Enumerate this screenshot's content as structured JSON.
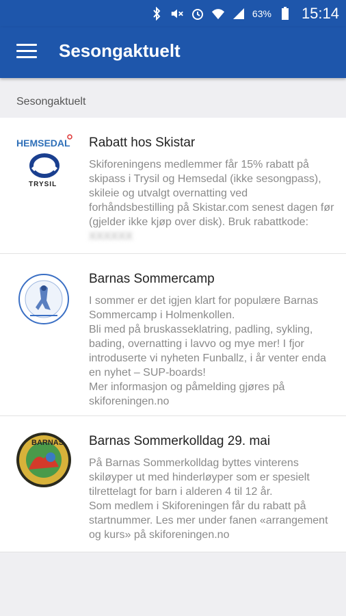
{
  "status_bar": {
    "battery_pct": "63%",
    "time": "15:14",
    "icons": [
      "bluetooth-icon",
      "mute-icon",
      "alarm-icon",
      "wifi-icon",
      "signal-icon",
      "battery-icon"
    ]
  },
  "app_bar": {
    "title": "Sesongaktuelt"
  },
  "section": {
    "header": "Sesongaktuelt"
  },
  "items": [
    {
      "title": "Rabatt hos Skistar",
      "body": "Skiforeningens medlemmer får 15% rabatt på skipass i Trysil og Hemsedal (ikke sesongpass), skileie og utvalgt overnatting ved forhåndsbestilling på Skistar.com senest dagen før (gjelder ikke kjøp over disk). Bruk rabattkode:",
      "redacted_code": "XXXXXX",
      "logo_text_top": "HEMSEDAL",
      "logo_text_bottom": "TRYSIL"
    },
    {
      "title": "Barnas Sommercamp",
      "body": "I sommer er det igjen klart for populære Barnas Sommercamp i Holmenkollen.\nBli med på bruskasseklatring, padling, sykling, bading, overnatting i lavvo og mye mer! I fjor introduserte vi nyheten Funballz, i år venter enda en nyhet – SUP-boards!\nMer informasjon og påmelding gjøres på skiforeningen.no"
    },
    {
      "title": "Barnas Sommerkolldag 29. mai",
      "body": "På Barnas Sommerkolldag byttes vinterens skiløyper ut med hinderløyper som er spesielt tilrettelagt for barn i alderen 4 til 12 år.\nSom medlem i Skiforeningen får du rabatt på startnummer. Les mer under fanen «arrangement og kurs» på skiforeningen.no",
      "logo_text": "BARNAS"
    }
  ],
  "colors": {
    "primary": "#1e56ab",
    "background": "#efeff2",
    "body_text": "#8a8a8a"
  }
}
